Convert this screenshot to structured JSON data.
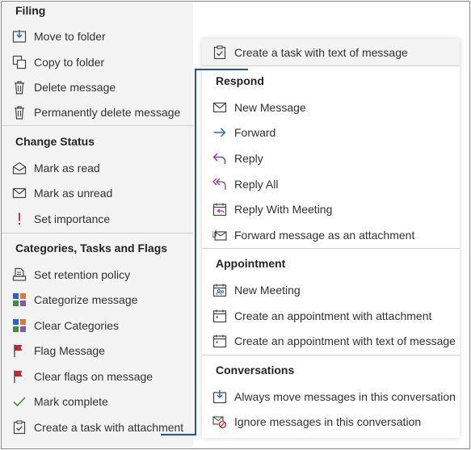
{
  "left_menu": {
    "filing": {
      "header": "Filing",
      "items": [
        {
          "label": "Move to folder",
          "icon": "move-to-folder-icon"
        },
        {
          "label": "Copy to folder",
          "icon": "copy-to-folder-icon"
        },
        {
          "label": "Delete message",
          "icon": "trash-icon"
        },
        {
          "label": "Permanently delete message",
          "icon": "trash-icon"
        }
      ]
    },
    "change_status": {
      "header": "Change Status",
      "items": [
        {
          "label": "Mark as read",
          "icon": "open-envelope-icon"
        },
        {
          "label": "Mark as unread",
          "icon": "envelope-icon"
        },
        {
          "label": "Set importance",
          "icon": "exclamation-icon"
        }
      ]
    },
    "categories": {
      "header": "Categories, Tasks and Flags",
      "items": [
        {
          "label": "Set retention policy",
          "icon": "retention-policy-icon"
        },
        {
          "label": "Categorize message",
          "icon": "category-grid-icon"
        },
        {
          "label": "Clear Categories",
          "icon": "category-grid-icon"
        },
        {
          "label": "Flag Message",
          "icon": "red-flag-icon"
        },
        {
          "label": "Clear flags on message",
          "icon": "red-flag-icon"
        },
        {
          "label": "Mark complete",
          "icon": "checkmark-icon"
        },
        {
          "label": "Create a task with attachment",
          "icon": "clipboard-task-icon"
        }
      ]
    }
  },
  "right_menu": {
    "top_item": {
      "label": "Create a task with text of message",
      "icon": "clipboard-task-icon"
    },
    "respond": {
      "header": "Respond",
      "items": [
        {
          "label": "New Message",
          "icon": "envelope-icon"
        },
        {
          "label": "Forward",
          "icon": "forward-arrow-icon"
        },
        {
          "label": "Reply",
          "icon": "reply-arrow-icon"
        },
        {
          "label": "Reply All",
          "icon": "reply-all-arrow-icon"
        },
        {
          "label": "Reply With Meeting",
          "icon": "calendar-reply-icon"
        },
        {
          "label": "Forward message as an attachment",
          "icon": "attachment-envelope-icon"
        }
      ]
    },
    "appointment": {
      "header": "Appointment",
      "items": [
        {
          "label": "New Meeting",
          "icon": "calendar-people-icon"
        },
        {
          "label": "Create an appointment with attachment",
          "icon": "calendar-icon"
        },
        {
          "label": "Create an appointment with text of message",
          "icon": "calendar-icon"
        }
      ]
    },
    "conversations": {
      "header": "Conversations",
      "items": [
        {
          "label": "Always move messages in this conversation",
          "icon": "move-conversation-icon"
        },
        {
          "label": "Ignore messages in this conversation",
          "icon": "ignore-conversation-icon"
        }
      ]
    }
  },
  "colors": {
    "accent_blue": "#1b4fc9",
    "flag_red": "#c4262e",
    "reply_purple": "#8b3a9c",
    "check_green": "#3b8e3b"
  }
}
